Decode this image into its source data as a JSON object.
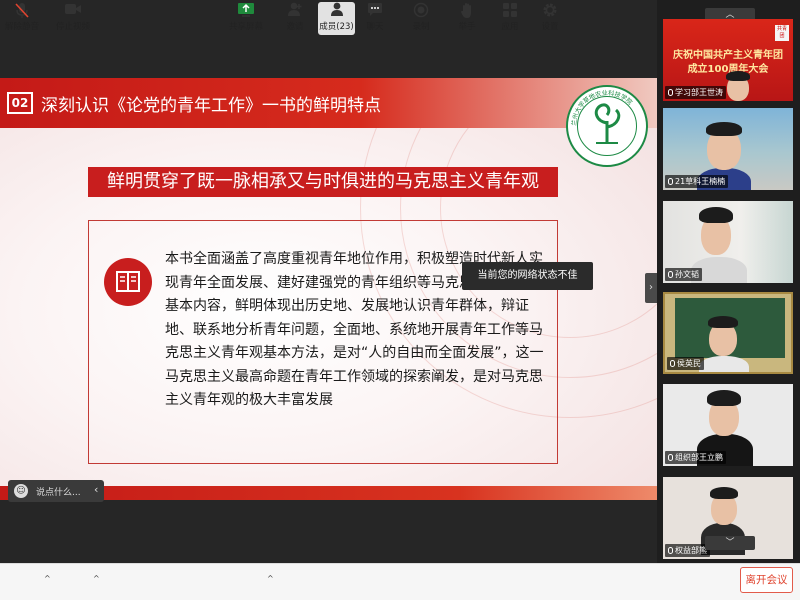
{
  "slide": {
    "number": "02",
    "title": "深刻认识《论党的青年工作》一书的鲜明特点",
    "banner": "鲜明贯穿了既一脉相承又与时俱进的马克思主义青年观",
    "body": "本书全面涵盖了高度重视青年地位作用，积极塑造时代新人实现青年全面发展、建好建强党的青年组织等马克思主义青年观基本内容，鲜明体现出历史地、发展地认识青年群体，辩证地、联系地分析青年问题，全面地、系统地开展青年工作等马克思主义青年观基本方法，是对“人的自由而全面发展”，这一马克思主义最高命题在青年工作领域的探索阐发，是对马克思主义青年观的极大丰富发展",
    "logo_text": "兰州大学草地农业科技学院"
  },
  "network_tooltip": "当前您的网络状态不佳",
  "chat": {
    "placeholder": "说点什么...",
    "collapse": "‹"
  },
  "participants": [
    {
      "name": "学习部王世涛",
      "poster_line1": "庆祝中国共产主义青年团",
      "poster_line2": "成立100周年大会",
      "stamp": "共青团"
    },
    {
      "name": "21草科王楠楠"
    },
    {
      "name": "孙文韬"
    },
    {
      "name": "侯英民"
    },
    {
      "name": "组织部王立鹏"
    },
    {
      "name": "权益部熊"
    }
  ],
  "colors": {
    "accent_red": "#c81e1e",
    "leave_red": "#e0442f",
    "logo_green": "#1d8a45"
  },
  "toolbar": {
    "unmute": "解除静音",
    "stop_video": "停止视频",
    "share_screen": "共享屏幕",
    "invite": "邀请",
    "members": "成员(23)",
    "chat": "聊天",
    "record": "录制",
    "raise_hand": "举手",
    "apps": "应用",
    "settings": "设置",
    "leave": "离开会议"
  },
  "icons": {
    "unmute": "muted-mic-icon",
    "stop_video": "video-camera-icon",
    "share_screen": "share-screen-icon",
    "invite": "add-person-icon",
    "members": "members-icon",
    "chat": "chat-icon",
    "record": "record-icon",
    "raise_hand": "hand-icon",
    "apps": "apps-icon",
    "settings": "gear-icon"
  }
}
